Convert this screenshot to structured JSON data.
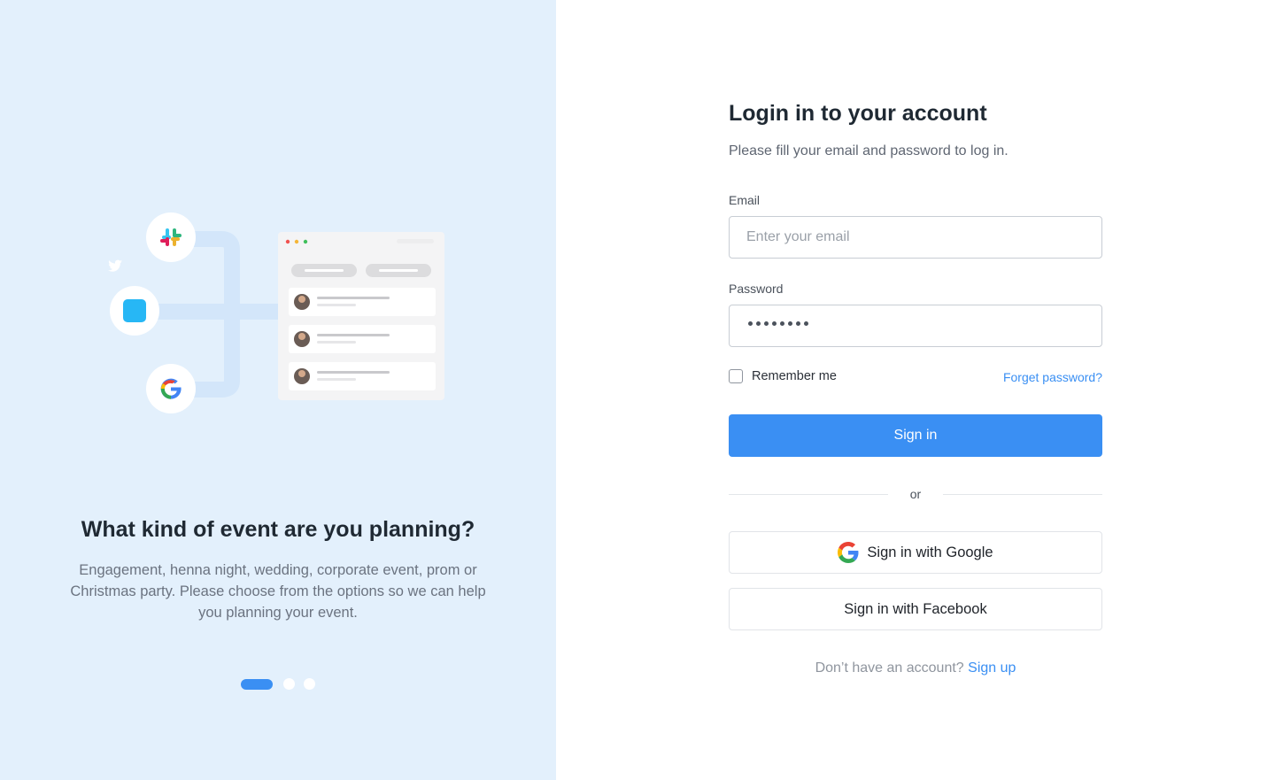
{
  "hero": {
    "title": "What kind of event are you planning?",
    "description": "Engagement, henna night, wedding, corporate event, prom or Christmas party. Please choose from the options so we can help you planning your event.",
    "carousel_count": 3,
    "carousel_active_index": 0,
    "integration_icons": [
      "slack-icon",
      "twitter-icon",
      "google-icon"
    ]
  },
  "login": {
    "title": "Login in to your account",
    "subtitle": "Please fill your email and password to log in.",
    "email_label": "Email",
    "email_placeholder": "Enter your email",
    "password_label": "Password",
    "password_mask": "••••••••",
    "remember_label": "Remember me",
    "forgot_label": "Forget password?",
    "sign_in_label": "Sign in",
    "or_label": "or",
    "google_label": "Sign in with Google",
    "facebook_label": "Sign in with Facebook",
    "signup_prompt": "Don’t have an account?",
    "signup_link": "Sign up"
  },
  "colors": {
    "accent": "#3a8ff3",
    "left_panel_bg": "#e3f0fc"
  }
}
